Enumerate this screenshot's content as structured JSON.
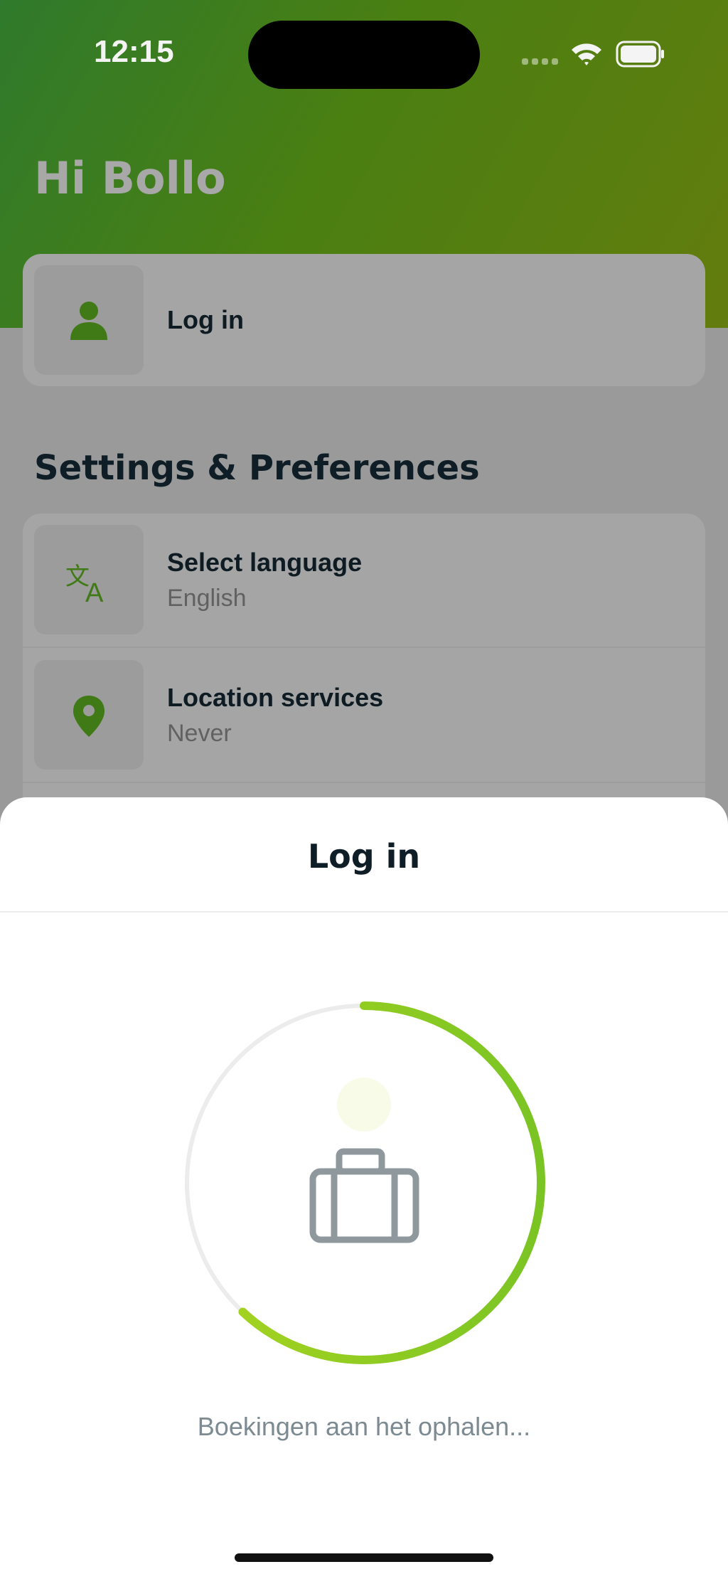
{
  "status_bar": {
    "time": "12:15"
  },
  "header": {
    "greeting": "Hi Bollo"
  },
  "login_card": {
    "label": "Log in",
    "icon": "person-icon"
  },
  "settings": {
    "section_title": "Settings & Preferences",
    "items": [
      {
        "title": "Select language",
        "value": "English",
        "icon": "translate-icon"
      },
      {
        "title": "Location services",
        "value": "Never",
        "icon": "location-pin-icon"
      }
    ]
  },
  "sheet": {
    "title": "Log in",
    "loading_text": "Boekingen aan het ophalen...",
    "progress_fraction": 0.62,
    "icon": "suitcase-icon"
  },
  "colors": {
    "brand_green": "#4c8a1c",
    "progress_light": "#a8d420",
    "progress_dark": "#7ac424"
  }
}
